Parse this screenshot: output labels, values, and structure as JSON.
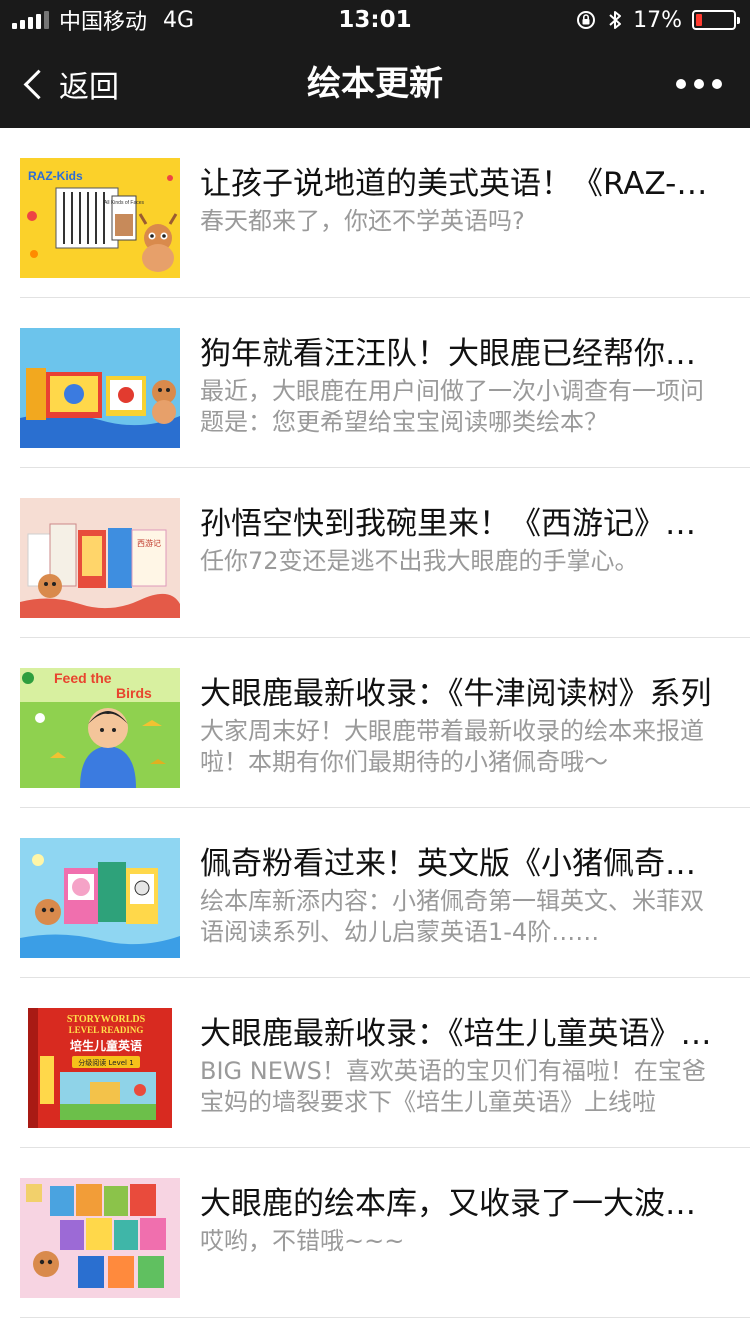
{
  "status_bar": {
    "carrier": "中国移动",
    "network": "4G",
    "time": "13:01",
    "battery_percent": "17%",
    "battery_level": 0.17,
    "battery_color": "#ff3b30",
    "icons": [
      "signal-icon",
      "orientation-lock-icon",
      "bluetooth-icon",
      "battery-icon"
    ]
  },
  "nav": {
    "back_label": "返回",
    "title": "绘本更新",
    "more_icon": "ellipsis-icon"
  },
  "articles": [
    {
      "title": "让孩子说地道的美式英语！《RAZ-Kids》",
      "desc": "春天都来了，你还不学英语吗?"
    },
    {
      "title": "狗年就看汪汪队！大眼鹿已经帮你准备好了",
      "desc": "最近，大眼鹿在用户间做了一次小调查有一项问题是：您更希望给宝宝阅读哪类绘本？"
    },
    {
      "title": "孙悟空快到我碗里来！《西游记》系列绘本",
      "desc": "任你72变还是逃不出我大眼鹿的手掌心。"
    },
    {
      "title": "大眼鹿最新收录：《牛津阅读树》系列",
      "desc": "大家周末好！大眼鹿带着最新收录的绘本来报道啦！本期有你们最期待的小猪佩奇哦～"
    },
    {
      "title": "佩奇粉看过来！英文版《小猪佩奇》上线",
      "desc": "绘本库新添内容：小猪佩奇第一辑英文、米菲双语阅读系列、幼儿启蒙英语1-4阶……"
    },
    {
      "title": "大眼鹿最新收录：《培生儿童英语》分级阅读",
      "desc": "BIG NEWS！喜欢英语的宝贝们有福啦！在宝爸宝妈的墙裂要求下《培生儿童英语》上线啦"
    },
    {
      "title": "大眼鹿的绘本库，又收录了一大波好书",
      "desc": "哎哟，不错哦~~~"
    }
  ],
  "thumbnails": {
    "raz_badge": "RAZ-Kids",
    "raz_book": "All Kinds of Faces",
    "xiyou_badge": "西游记",
    "feed_title_1": "Feed the",
    "feed_title_2": "Birds",
    "pearson_top": "STORYWORLDS",
    "pearson_mid": "LEVEL READING",
    "pearson_cn": "培生儿童英语",
    "pearson_level": "分级阅读 Level 1"
  }
}
